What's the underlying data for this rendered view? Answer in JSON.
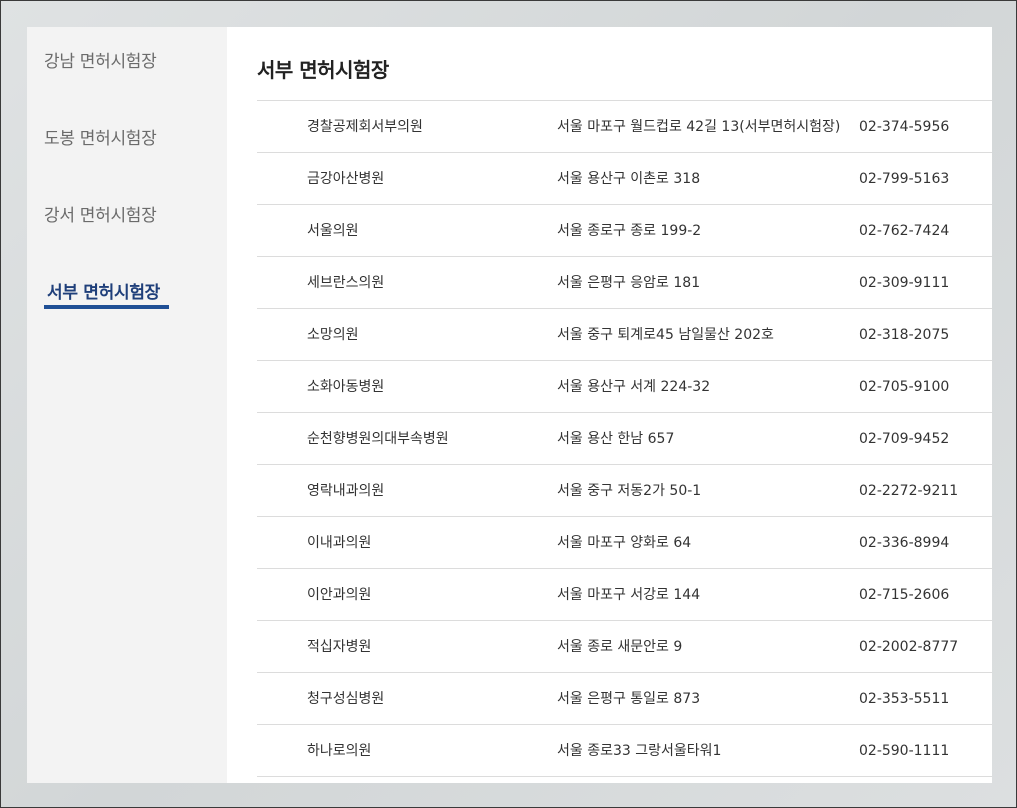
{
  "sidebar": {
    "items": [
      {
        "label": "강남 면허시험장"
      },
      {
        "label": "도봉 면허시험장"
      },
      {
        "label": "강서 면허시험장"
      },
      {
        "label": "서부 면허시험장"
      }
    ],
    "active_index": 3
  },
  "main": {
    "title": "서부 면허시험장",
    "rows": [
      {
        "name": "경찰공제회서부의원",
        "address": "서울 마포구 월드컵로 42길 13(서부면허시험장)",
        "phone": "02-374-5956"
      },
      {
        "name": "금강아산병원",
        "address": "서울 용산구 이촌로 318",
        "phone": "02-799-5163"
      },
      {
        "name": "서울의원",
        "address": "서울 종로구 종로 199-2",
        "phone": "02-762-7424"
      },
      {
        "name": "세브란스의원",
        "address": "서울 은평구 응암로 181",
        "phone": "02-309-9111"
      },
      {
        "name": "소망의원",
        "address": "서울 중구 퇴계로45 남일물산 202호",
        "phone": "02-318-2075"
      },
      {
        "name": "소화아동병원",
        "address": "서울 용산구 서계 224-32",
        "phone": "02-705-9100"
      },
      {
        "name": "순천향병원의대부속병원",
        "address": "서울 용산 한남 657",
        "phone": "02-709-9452"
      },
      {
        "name": "영락내과의원",
        "address": "서울 중구 저동2가 50-1",
        "phone": "02-2272-9211"
      },
      {
        "name": "이내과의원",
        "address": "서울 마포구 양화로 64",
        "phone": "02-336-8994"
      },
      {
        "name": "이안과의원",
        "address": "서울 마포구 서강로 144",
        "phone": "02-715-2606"
      },
      {
        "name": "적십자병원",
        "address": "서울 종로 새문안로 9",
        "phone": "02-2002-8777"
      },
      {
        "name": "청구성심병원",
        "address": "서울 은평구 통일로 873",
        "phone": "02-353-5511"
      },
      {
        "name": "하나로의원",
        "address": "서울 종로33 그랑서울타워1",
        "phone": "02-590-1111"
      }
    ]
  },
  "colors": {
    "accent": "#1f4f95",
    "active_text": "#1f3f7a",
    "sidebar_bg": "#f3f3f3"
  }
}
